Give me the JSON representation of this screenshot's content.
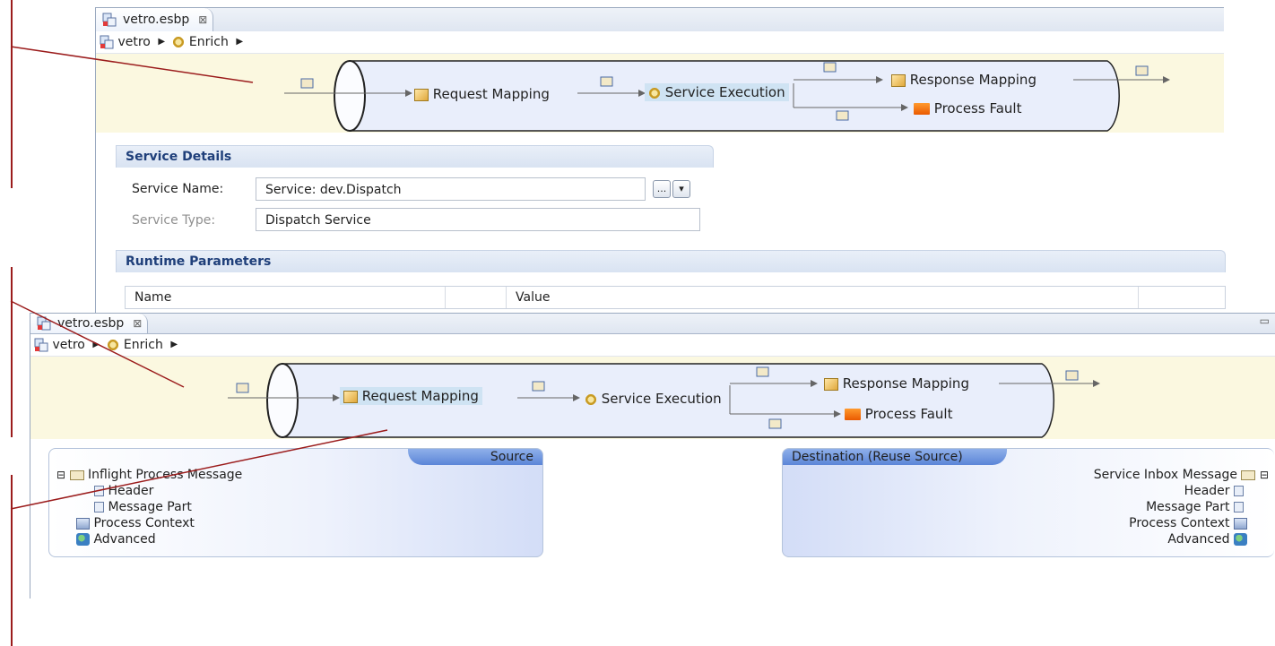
{
  "top_editor": {
    "tab_title": "vetro.esbp",
    "tab_close": "⊠",
    "breadcrumb": [
      "vetro",
      "Enrich"
    ],
    "flow": {
      "request_mapping": "Request Mapping",
      "service_execution": "Service Execution",
      "response_mapping": "Response Mapping",
      "process_fault": "Process Fault"
    },
    "service_details": {
      "title": "Service Details",
      "service_name_label": "Service Name:",
      "service_name_value": "Service: dev.Dispatch",
      "browse_button": "...",
      "dropdown_button": "▾",
      "service_type_label": "Service Type:",
      "service_type_value": "Dispatch Service"
    },
    "runtime_parameters": {
      "title": "Runtime Parameters",
      "columns": [
        "Name",
        "Value"
      ]
    }
  },
  "bottom_editor": {
    "tab_title": "vetro.esbp",
    "tab_close": "⊠",
    "minimize": "▭",
    "breadcrumb": [
      "vetro",
      "Enrich"
    ],
    "flow": {
      "request_mapping": "Request Mapping",
      "service_execution": "Service Execution",
      "response_mapping": "Response Mapping",
      "process_fault": "Process Fault"
    },
    "source": {
      "title": "Source",
      "expand_toggle": "⊟",
      "items": [
        "Inflight Process Message",
        "Header",
        "Message Part",
        "Process Context",
        "Advanced"
      ]
    },
    "destination": {
      "title": "Destination (Reuse Source)",
      "expand_toggle": "⊟",
      "items": [
        "Service Inbox Message",
        "Header",
        "Message Part",
        "Process Context",
        "Advanced"
      ]
    }
  },
  "colors": {
    "flow_band": "#fbf8e0",
    "section_title": "#1f3f7a",
    "annotation_line": "#9b1c1c",
    "panel_header": "#5b85d8"
  }
}
